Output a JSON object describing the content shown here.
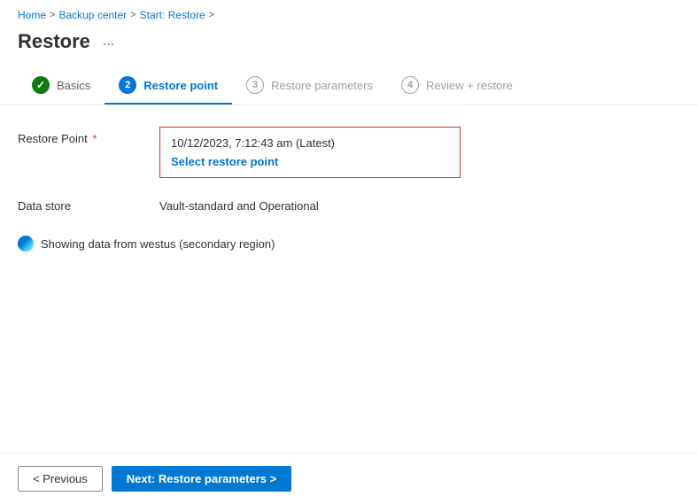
{
  "breadcrumb": {
    "home": "Home",
    "sep1": ">",
    "backup_center": "Backup center",
    "sep2": ">",
    "start_restore": "Start: Restore",
    "sep3": ">"
  },
  "page": {
    "title": "Restore",
    "more_options": "..."
  },
  "tabs": [
    {
      "id": "basics",
      "number": "1",
      "label": "Basics",
      "state": "completed"
    },
    {
      "id": "restore-point",
      "number": "2",
      "label": "Restore point",
      "state": "active"
    },
    {
      "id": "restore-parameters",
      "number": "3",
      "label": "Restore parameters",
      "state": "inactive"
    },
    {
      "id": "review-restore",
      "number": "4",
      "label": "Review + restore",
      "state": "inactive"
    }
  ],
  "form": {
    "restore_point_label": "Restore Point",
    "restore_point_value": "10/12/2023, 7:12:43 am (Latest)",
    "select_link": "Select restore point",
    "data_store_label": "Data store",
    "data_store_value": "Vault-standard and Operational",
    "info_text": "Showing data from westus (secondary region)"
  },
  "footer": {
    "previous": "< Previous",
    "next": "Next: Restore parameters >"
  }
}
